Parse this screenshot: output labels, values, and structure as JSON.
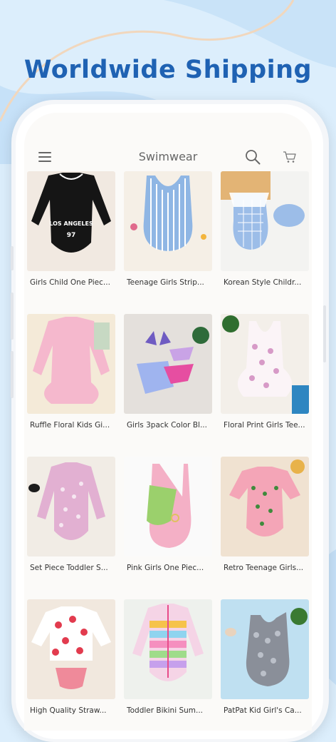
{
  "headline": "Worldwide Shipping",
  "app": {
    "title": "Swimwear",
    "icons": [
      "menu-icon",
      "search-icon",
      "cart-icon"
    ]
  },
  "colors": {
    "headline": "#1f62b3",
    "background": "#dceefc",
    "screen": "#fbfaf8"
  },
  "products": [
    {
      "title": "Girls Child One Piec...",
      "bg": "#f1e9e1"
    },
    {
      "title": "Teenage Girls Strip...",
      "bg": "#f5efe6"
    },
    {
      "title": "Korean Style Childr...",
      "bg": "#f3f3f1"
    },
    {
      "title": "Ruffle Floral Kids Gi...",
      "bg": "#f4ead8"
    },
    {
      "title": "Girls 3pack Color Bl...",
      "bg": "#e4e0dc"
    },
    {
      "title": "Floral Print Girls Tee...",
      "bg": "#f3efe9"
    },
    {
      "title": "Set Piece Toddler S...",
      "bg": "#f1ece5"
    },
    {
      "title": "Pink Girls One Piec...",
      "bg": "#fafafa"
    },
    {
      "title": "Retro Teenage Girls...",
      "bg": "#f0e2d1"
    },
    {
      "title": "High Quality Straw...",
      "bg": "#f1e8de"
    },
    {
      "title": "Toddler Bikini Sum...",
      "bg": "#eef1ed"
    },
    {
      "title": "PatPat Kid Girl's Ca...",
      "bg": "#bfe0f1"
    }
  ]
}
